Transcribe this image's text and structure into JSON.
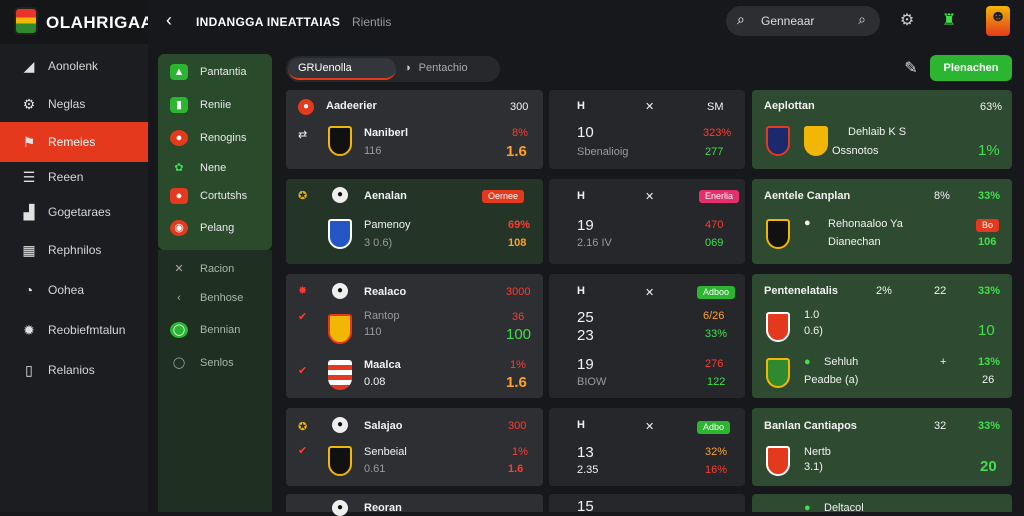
{
  "app": {
    "brand": "OLAHRIGAA",
    "title": "INDANGGA INEATTAIAS",
    "subtitle": "Rientiis"
  },
  "search": {
    "placeholder": "Genneaar"
  },
  "nav": [
    {
      "label": "Aonolenk",
      "icon": "speaker-icon"
    },
    {
      "label": "Neglas",
      "icon": "gear-icon"
    },
    {
      "label": "Remeies",
      "icon": "flag-icon",
      "active": true
    },
    {
      "label": "Reeen",
      "icon": "menu-icon"
    },
    {
      "label": "Gogetaraes",
      "icon": "chart-icon"
    },
    {
      "label": "Rephnilos",
      "icon": "grid-icon"
    },
    {
      "label": "Oohea",
      "icon": "clock-icon"
    },
    {
      "label": "Reobiefmtalun",
      "icon": "settings-icon"
    },
    {
      "label": "Relanios",
      "icon": "phone-icon"
    }
  ],
  "filters": [
    {
      "label": "Pantantia",
      "color": "#2bb531"
    },
    {
      "label": "Reniie",
      "color": "#2bb531"
    },
    {
      "label": "Renogins",
      "color": "#e5391d"
    },
    {
      "label": "Nene",
      "color": "#2bb531"
    },
    {
      "label": "Cortutshs",
      "color": "#e5391d"
    },
    {
      "label": "Pelang",
      "color": "#e5391d"
    },
    {
      "label": "Racion",
      "color": "#555"
    },
    {
      "label": "Benhose",
      "color": "#555"
    },
    {
      "label": "Bennian",
      "color": "#2bb531"
    },
    {
      "label": "Senlos",
      "color": "#555"
    }
  ],
  "tabs": {
    "active": "GRUenolla",
    "inactive": "Pentachio"
  },
  "action_button": "Plenachen",
  "rows": [
    {
      "left": {
        "title": "Aadeerier",
        "code": "300",
        "team": "Naniberl",
        "sub": "116",
        "pct": "8%",
        "val": "1.6"
      },
      "mid": {
        "h": "H",
        "x": "✕",
        "code": "SM",
        "n1": "10",
        "n2": "Sbenalioig",
        "p1": "323%",
        "p2": "277"
      },
      "right": {
        "title": "Aeplottan",
        "pct": "63%",
        "team": "Dehlaib K S",
        "sub": "Ossnotos",
        "val": "1%"
      }
    },
    {
      "left": {
        "title": "Aenalan",
        "badge": "Oernee",
        "team": "Pamenoy",
        "sub": "3 0.6)",
        "pct": "69%",
        "val": "108"
      },
      "mid": {
        "h": "H",
        "x": "✕",
        "badge": "Enerlia",
        "n1": "19",
        "n2": "2.16 IV",
        "p1": "470",
        "p2": "069"
      },
      "right": {
        "title": "Aentele Canplan",
        "pct": "8%",
        "pct2": "33%",
        "team": "Rehonaaloo Ya",
        "sub": "Dianechan",
        "badge": "Bo",
        "val": "106"
      }
    },
    {
      "left": {
        "title": "Realaco",
        "code": "3000",
        "team": "Rantop",
        "sub": "110",
        "pct": "36",
        "val": "100",
        "title2": "Maalca",
        "sub2": "0.08",
        "pct2": "1%",
        "val2": "1.6"
      },
      "mid": {
        "h": "H",
        "x": "✕",
        "badge": "Adboo",
        "n1": "25",
        "n2": "23",
        "p1": "6/26",
        "p2": "33%",
        "n3": "19",
        "n4": "BIOW",
        "p3": "276",
        "p4": "122"
      },
      "right": {
        "title": "Pentenelatalis",
        "a": "2%",
        "b": "22",
        "pct": "33%",
        "l1": "1.0",
        "l2": "0.6)",
        "val": "10",
        "team": "Sehluh",
        "sub": "Peadbe (a)",
        "val2": "13%",
        "val3": "26"
      }
    },
    {
      "left": {
        "title": "Salajao",
        "code": "300",
        "team": "Senbeial",
        "sub": "0.61",
        "pct": "1%",
        "val": "1.6"
      },
      "mid": {
        "h": "H",
        "x": "✕",
        "badge": "Adbo",
        "n1": "13",
        "n2": "2.35",
        "p1": "32%",
        "p2": "16%"
      },
      "right": {
        "title": "Banlan Cantiapos",
        "a": "32",
        "pct": "33%",
        "team": "Nertb",
        "sub": "3.1)",
        "val": "20"
      }
    },
    {
      "left": {
        "title": "Reoran"
      },
      "mid": {
        "n1": "15"
      },
      "right": {
        "title": "Deltacol"
      }
    }
  ]
}
